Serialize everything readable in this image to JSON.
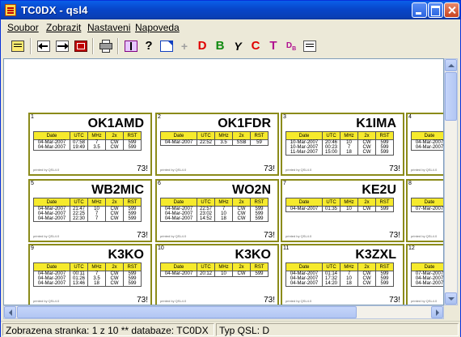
{
  "window": {
    "title": "TC0DX - qsl4"
  },
  "menu": [
    "Soubor",
    "Zobrazit",
    "Nastaveni",
    "Napoveda"
  ],
  "toolbar": {
    "letter_d1": "D",
    "letter_b": "B",
    "letter_y": "Y",
    "letter_c": "C",
    "letter_t": "T",
    "letter_db": "D",
    "colors": {
      "d1": "#e00000",
      "b": "#108a10",
      "y": "#000000",
      "c": "#e00000",
      "t": "#b01090",
      "db": "#b01090"
    }
  },
  "table_headers": [
    "Date",
    "UTC",
    "MHz",
    "2x",
    "RST"
  ],
  "card_footer": "printed by QSL4.0",
  "card_closing": "73!",
  "cards": [
    {
      "num": "1",
      "call": "OK1AMD",
      "rows": [
        [
          "04-Mar-2007",
          "07:58",
          "7",
          "CW",
          "599"
        ],
        [
          "04-Mar-2007",
          "19:49",
          "3.5",
          "CW",
          "599"
        ]
      ]
    },
    {
      "num": "2",
      "call": "OK1FDR",
      "rows": [
        [
          "04-Mar-2007",
          "22:52",
          "3.5",
          "SSB",
          "59"
        ]
      ]
    },
    {
      "num": "3",
      "call": "K1IMA",
      "rows": [
        [
          "10-Mar-2007",
          "20:46",
          "10",
          "CW",
          "599"
        ],
        [
          "10-Mar-2007",
          "00:23",
          "7",
          "CW",
          "599"
        ],
        [
          "11-Mar-2007",
          "15:00",
          "18",
          "CW",
          "599"
        ]
      ]
    },
    {
      "num": "4",
      "call": "",
      "rows": [
        [
          "04-Mar-2007",
          "",
          "",
          "",
          ""
        ],
        [
          "04-Mar-2007",
          "",
          "",
          "",
          ""
        ]
      ]
    },
    {
      "num": "5",
      "call": "WB2MIC",
      "rows": [
        [
          "04-Mar-2007",
          "21:47",
          "10",
          "CW",
          "599"
        ],
        [
          "04-Mar-2007",
          "22:25",
          "7",
          "CW",
          "599"
        ],
        [
          "04-Mar-2007",
          "22:30",
          "7",
          "CW",
          "599"
        ]
      ]
    },
    {
      "num": "6",
      "call": "WO2N",
      "rows": [
        [
          "04-Mar-2007",
          "22:57",
          "7",
          "CW",
          "599"
        ],
        [
          "04-Mar-2007",
          "23:02",
          "10",
          "CW",
          "599"
        ],
        [
          "04-Mar-2007",
          "14:52",
          "18",
          "CW",
          "599"
        ]
      ]
    },
    {
      "num": "7",
      "call": "KE2U",
      "rows": [
        [
          "04-Mar-2007",
          "01:35",
          "10",
          "CW",
          "599"
        ]
      ]
    },
    {
      "num": "8",
      "call": "",
      "rows": [
        [
          "07-Mar-2007",
          "",
          "",
          "",
          ""
        ]
      ]
    },
    {
      "num": "9",
      "call": "K3KO",
      "rows": [
        [
          "04-Mar-2007",
          "00:11",
          "7",
          "CW",
          "599"
        ],
        [
          "04-Mar-2007",
          "01:26",
          "3.5",
          "CW",
          "599"
        ],
        [
          "04-Mar-2007",
          "13:46",
          "18",
          "CW",
          "599"
        ]
      ]
    },
    {
      "num": "10",
      "call": "K3KO",
      "rows": [
        [
          "04-Mar-2007",
          "20:12",
          "10",
          "CW",
          "599"
        ]
      ]
    },
    {
      "num": "11",
      "call": "K3ZXL",
      "rows": [
        [
          "04-Mar-2007",
          "01:14",
          "7",
          "CW",
          "599"
        ],
        [
          "04-Mar-2007",
          "17:32",
          "10",
          "CW",
          "599"
        ],
        [
          "04-Mar-2007",
          "14:20",
          "18",
          "CW",
          "599"
        ]
      ]
    },
    {
      "num": "12",
      "call": "",
      "rows": [
        [
          "07-Mar-2007",
          "",
          "",
          "",
          ""
        ],
        [
          "04-Mar-2007",
          "",
          "",
          "",
          ""
        ],
        [
          "04-Mar-2007",
          "",
          "",
          "",
          ""
        ]
      ]
    }
  ],
  "status": {
    "page_info": "Zobrazena stranka:  1 z 10 ** databaze: TC0DX",
    "qsl_type": "Typ QSL: D"
  }
}
